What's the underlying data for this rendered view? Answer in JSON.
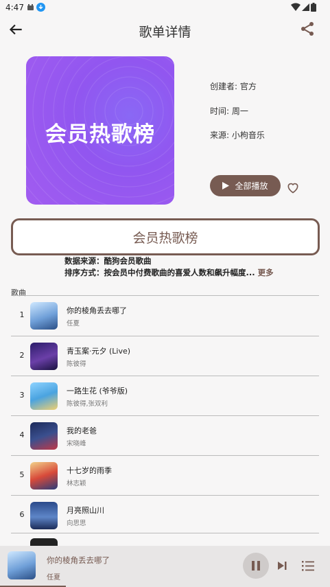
{
  "status_bar": {
    "time": "4:47"
  },
  "app_bar": {
    "title": "歌单详情"
  },
  "playlist": {
    "cover_title": "会员热歌榜",
    "creator": "创建者: 官方",
    "time": "时间: 周一",
    "source": "来源: 小枸音乐",
    "play_all_label": "全部播放",
    "name_button": "会员热歌榜",
    "data_source": "数据来源：酷狗会员歌曲",
    "sort_method": "排序方式：按会员中付费歌曲的喜爱人数和飙升幅度...",
    "more_label": "更多"
  },
  "songs_label": "歌曲",
  "songs": [
    {
      "index": "1",
      "name": "你的棱角丢去哪了",
      "artist": "任夏"
    },
    {
      "index": "2",
      "name": "青玉案·元夕 (Live)",
      "artist": "陈彼得"
    },
    {
      "index": "3",
      "name": "一路生花 (爷爷版)",
      "artist": "陈彼得,张双利"
    },
    {
      "index": "4",
      "name": "我的老爸",
      "artist": "宋晓峰"
    },
    {
      "index": "5",
      "name": "十七岁的雨季",
      "artist": "林志颖"
    },
    {
      "index": "6",
      "name": "月亮照山川",
      "artist": "向思思"
    }
  ],
  "player": {
    "name": "你的棱角丢去哪了",
    "artist": "任夏",
    "progress": 0.2
  },
  "colors": {
    "accent": "#775b52",
    "cover": "#9156f0"
  }
}
